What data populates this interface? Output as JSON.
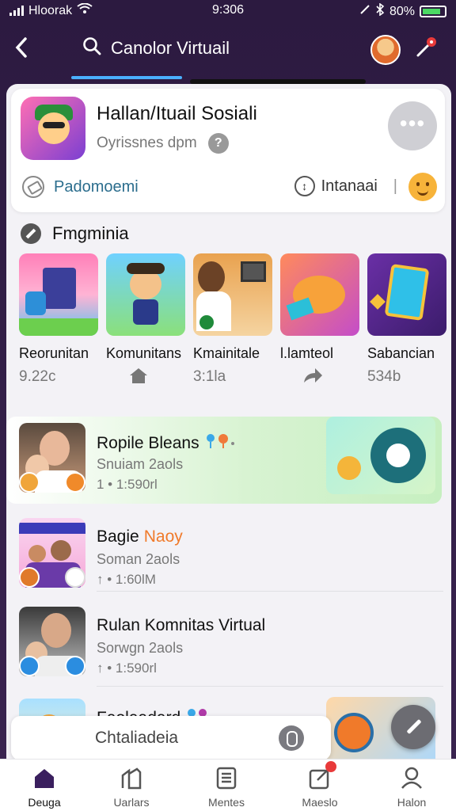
{
  "status_bar": {
    "carrier": "Hloorak",
    "time": "9:306",
    "battery": "80%"
  },
  "header": {
    "search_label": "Canolor Virtuail"
  },
  "profile_card": {
    "name": "Hallan/Ituail Sosiali",
    "subtitle": "Oyrissnes dpm",
    "tag_label": "Padomoemi",
    "international_label": "Intanaai",
    "more_label": "•••"
  },
  "section": {
    "title": "Fmgminia",
    "tiles": [
      {
        "label": "Reorunitan",
        "value": "9.22c"
      },
      {
        "label": "Komunitans",
        "value": ""
      },
      {
        "label": "Kmainitale",
        "value": "3:1la"
      },
      {
        "label": "l.lamteol",
        "value": ""
      },
      {
        "label": "Sabancian",
        "value": "534b"
      }
    ]
  },
  "list": [
    {
      "title": "Ropile Bleans",
      "title_accent": "",
      "subtitle": "Snuiam 2aols",
      "meta": "1  •  1:590rl"
    },
    {
      "title": "Bagie ",
      "title_accent": "Naoy",
      "subtitle": "Soman 2aols",
      "meta": "↑  •  1:60lM"
    },
    {
      "title": "Rulan Komnitas Virtual",
      "title_accent": "",
      "subtitle": "Sorwgn 2aols",
      "meta": "↑  •  1:590rl"
    },
    {
      "title": "Faolaadard",
      "title_accent": "",
      "subtitle": "",
      "meta": ""
    }
  ],
  "chat": {
    "placeholder": "Chtaliadeia"
  },
  "bottom_nav": [
    {
      "label": "Deuga",
      "active": true
    },
    {
      "label": "Uarlars",
      "active": false
    },
    {
      "label": "Mentes",
      "active": false
    },
    {
      "label": "Maeslo",
      "active": false
    },
    {
      "label": "Halon",
      "active": false
    }
  ],
  "colors": {
    "accent": "#4ab0ff",
    "header_bg": "#2c1a40",
    "highlight": "#c6efc0",
    "badge": "#e83a3a"
  }
}
